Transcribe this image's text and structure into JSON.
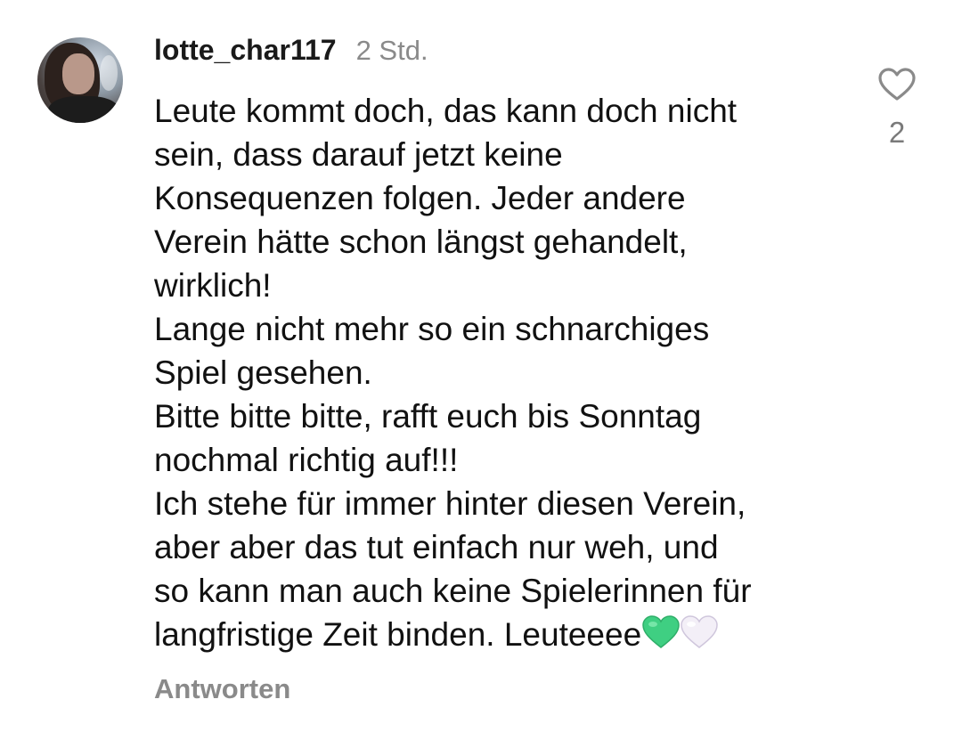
{
  "comment": {
    "username": "lotte_char117",
    "time": "2 Std.",
    "lines": [
      "Leute kommt doch, das kann doch nicht",
      "sein, dass darauf jetzt keine",
      "Konsequenzen folgen. Jeder andere",
      "Verein hätte schon längst gehandelt,",
      "wirklich!",
      "Lange nicht mehr so ein schnarchiges",
      "Spiel gesehen.",
      "Bitte bitte bitte, rafft euch bis Sonntag",
      "nochmal richtig auf!!!",
      "Ich stehe für immer hinter diesen Verein,",
      "aber aber das tut einfach nur weh, und",
      "so kann man auch keine Spielerinnen für",
      "langfristige Zeit binden. Leuteeee"
    ],
    "emojis": [
      "green-heart-icon",
      "white-heart-icon"
    ],
    "reply_label": "Antworten",
    "like_count": "2"
  },
  "colors": {
    "text": "#111111",
    "muted": "#8a8a8a",
    "green_heart": "#3fcf82",
    "white_heart": "#f1edf6"
  }
}
